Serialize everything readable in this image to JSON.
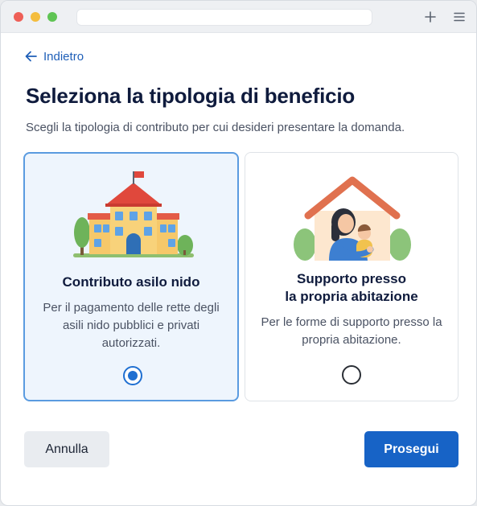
{
  "back_link": {
    "label": "Indietro"
  },
  "page": {
    "title": "Seleziona la tipologia di beneficio",
    "subtitle": "Scegli la tipologia di contributo per cui desideri presentare la domanda."
  },
  "options": [
    {
      "title": "Contributo asilo nido",
      "description": "Per il pagamento delle rette degli asili nido pubblici e privati autorizzati.",
      "selected": true,
      "icon": "school-building-icon"
    },
    {
      "title": "Supporto presso\nla propria abitazione",
      "description": "Per le forme di supporto presso la propria abitazione.",
      "selected": false,
      "icon": "home-care-icon"
    }
  ],
  "actions": {
    "cancel_label": "Annulla",
    "continue_label": "Prosegui"
  },
  "colors": {
    "accent": "#1763c6",
    "selected_border": "#5a9be0",
    "selected_background": "#eef5fd"
  }
}
